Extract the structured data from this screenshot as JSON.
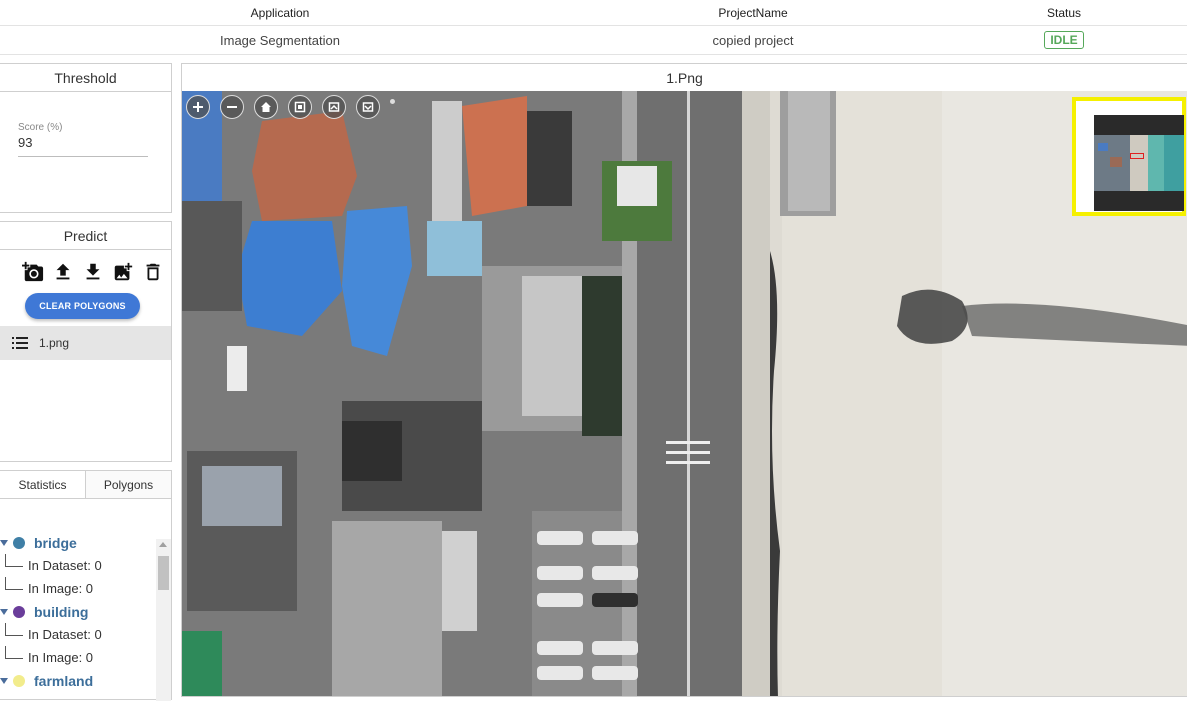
{
  "table": {
    "headers": [
      "Application",
      "ProjectName",
      "Status"
    ],
    "row": {
      "application": "Image Segmentation",
      "project_name": "copied project",
      "status": "IDLE"
    }
  },
  "threshold": {
    "title": "Threshold",
    "score_label": "Score (%)",
    "score_value": "93"
  },
  "predict": {
    "title": "Predict",
    "toolbar_icons": [
      "camera-add-icon",
      "upload-icon",
      "download-icon",
      "add-image-icon",
      "trash-icon"
    ],
    "clear_label": "CLEAR POLYGONS",
    "files": [
      "1.png"
    ]
  },
  "stats": {
    "tabs": [
      "Statistics",
      "Polygons"
    ],
    "classes": [
      {
        "name": "bridge",
        "color": "#3f7fa6",
        "in_dataset": "In Dataset: 0",
        "in_image": "In Image: 0"
      },
      {
        "name": "building",
        "color": "#6a3d9a",
        "in_dataset": "In Dataset: 0",
        "in_image": "In Image: 0"
      },
      {
        "name": "farmland",
        "color": "#f2ec8c"
      }
    ]
  },
  "viewer": {
    "title": "1.Png",
    "zoom_icons": [
      "zoom-in-icon",
      "zoom-out-icon",
      "home-icon",
      "fullscreen-icon",
      "rotate-left-icon",
      "rotate-right-icon"
    ]
  },
  "colors": {
    "accent": "#3f78d6",
    "status_idle": "#56a85a",
    "navigator_border": "#f5f000",
    "navigator_viewport": "#e02020"
  }
}
